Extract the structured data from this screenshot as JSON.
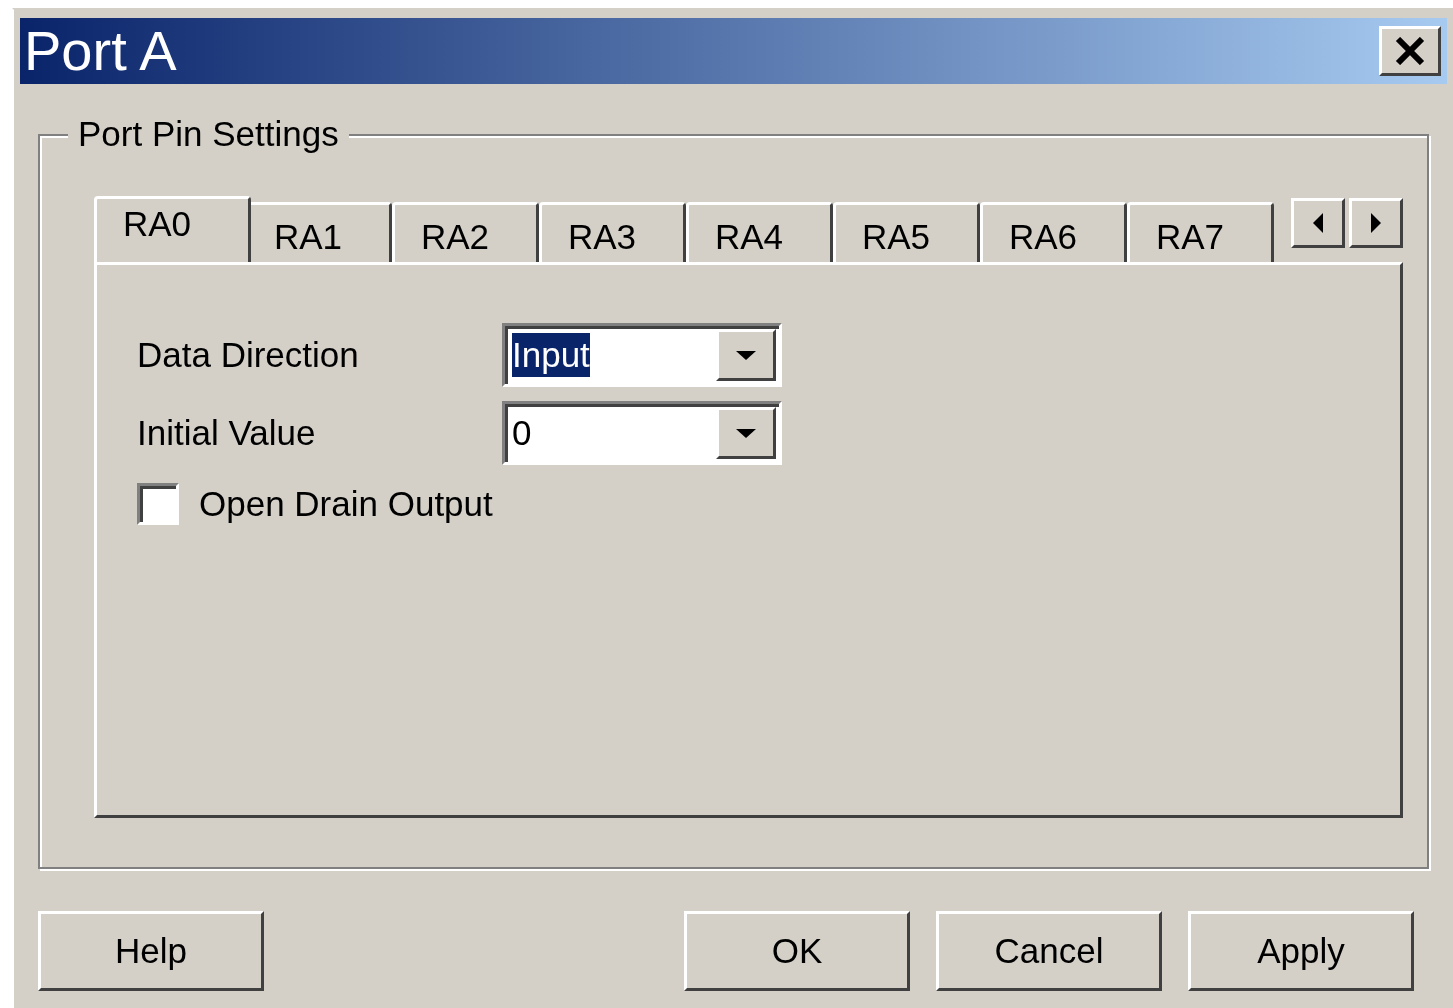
{
  "window": {
    "title": "Port A"
  },
  "group": {
    "title": "Port Pin Settings"
  },
  "tabs": [
    {
      "label": "RA0",
      "selected": true
    },
    {
      "label": "RA1",
      "selected": false
    },
    {
      "label": "RA2",
      "selected": false
    },
    {
      "label": "RA3",
      "selected": false
    },
    {
      "label": "RA4",
      "selected": false
    },
    {
      "label": "RA5",
      "selected": false
    },
    {
      "label": "RA6",
      "selected": false
    },
    {
      "label": "RA7",
      "selected": false
    }
  ],
  "fields": [
    {
      "kind": "dropdown",
      "label": "Data Direction",
      "value": "Input",
      "text_selected": true
    },
    {
      "kind": "dropdown",
      "label": "Initial Value",
      "value": "0",
      "text_selected": false
    },
    {
      "kind": "checkbox",
      "label": "Open Drain Output",
      "checked": false
    }
  ],
  "buttons": [
    {
      "label": "Help",
      "kind": "left"
    },
    {
      "label": "OK",
      "kind": "right"
    },
    {
      "label": "Cancel",
      "kind": "right"
    },
    {
      "label": "Apply",
      "kind": "right"
    }
  ]
}
